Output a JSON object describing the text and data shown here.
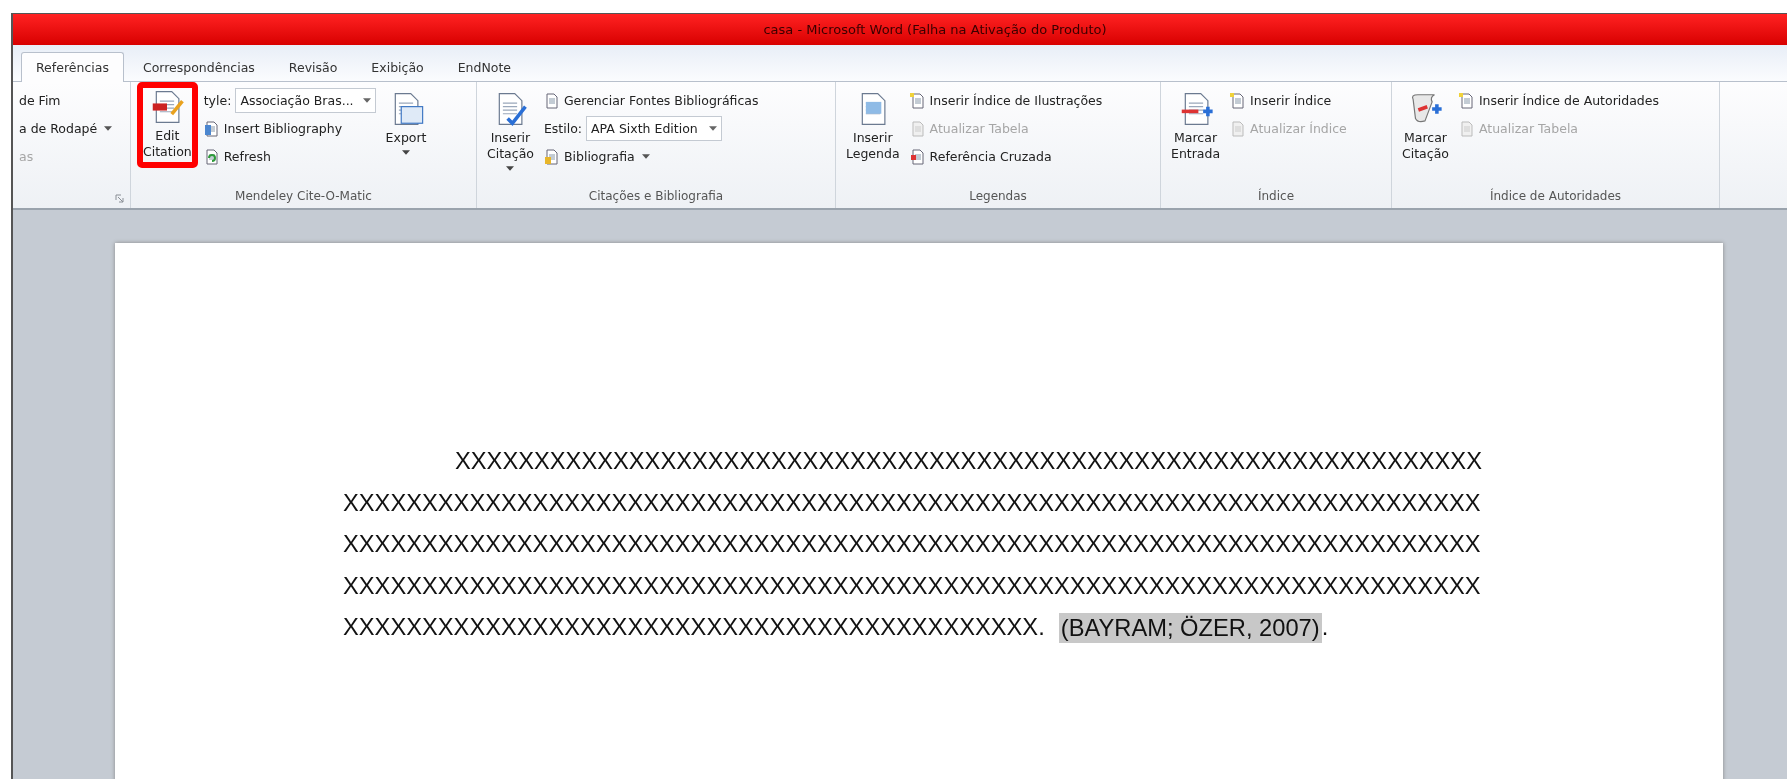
{
  "window": {
    "title": "casa - Microsoft Word (Falha na Ativação do Produto)"
  },
  "tabs": [
    {
      "label": "Referências",
      "selected": true
    },
    {
      "label": "Correspondências",
      "selected": false
    },
    {
      "label": "Revisão",
      "selected": false
    },
    {
      "label": "Exibição",
      "selected": false
    },
    {
      "label": "EndNote",
      "selected": false
    }
  ],
  "ribbon": {
    "groups": [
      {
        "launcher": true,
        "items": [
          {
            "kind": "column",
            "rows": [
              {
                "kind": "button",
                "label": "de Fim",
                "disabled": false
              },
              {
                "kind": "button",
                "label": "a de Rodapé",
                "caret": true,
                "disabled": false
              },
              {
                "kind": "button",
                "label": "as",
                "disabled": true
              }
            ]
          }
        ]
      },
      {
        "label": "Mendeley Cite-O-Matic",
        "items": [
          {
            "kind": "large",
            "label": "Edit Citation",
            "highlighted": true
          },
          {
            "kind": "column",
            "rows": [
              {
                "kind": "combo",
                "label": "tyle:",
                "value": "Associação Bras..."
              },
              {
                "kind": "button",
                "label": "Insert Bibliography",
                "disabled": false
              },
              {
                "kind": "button",
                "label": "Refresh",
                "disabled": false
              }
            ]
          },
          {
            "kind": "large",
            "label": "Export",
            "caret": true,
            "highlighted": false
          }
        ]
      },
      {
        "label": "Citações e Bibliografia",
        "items": [
          {
            "kind": "large",
            "label": "Inserir Citação",
            "caret": true,
            "highlighted": false
          },
          {
            "kind": "column",
            "rows": [
              {
                "kind": "button",
                "label": "Gerenciar Fontes Bibliográficas",
                "disabled": false
              },
              {
                "kind": "combo",
                "label": "Estilo:",
                "value": "APA Sixth Edition"
              },
              {
                "kind": "button",
                "label": "Bibliografia",
                "caret": true,
                "disabled": false
              }
            ]
          }
        ]
      },
      {
        "label": "Legendas",
        "items": [
          {
            "kind": "large",
            "label": "Inserir Legenda",
            "highlighted": false
          },
          {
            "kind": "column",
            "rows": [
              {
                "kind": "button",
                "label": "Inserir Índice de Ilustrações",
                "disabled": false
              },
              {
                "kind": "button",
                "label": "Atualizar Tabela",
                "disabled": true
              },
              {
                "kind": "button",
                "label": "Referência Cruzada",
                "disabled": false
              }
            ]
          }
        ]
      },
      {
        "label": "Índice",
        "items": [
          {
            "kind": "large",
            "label": "Marcar Entrada",
            "highlighted": false
          },
          {
            "kind": "column",
            "rows": [
              {
                "kind": "button",
                "label": "Inserir Índice",
                "disabled": false
              },
              {
                "kind": "button",
                "label": "Atualizar Índice",
                "disabled": true
              }
            ]
          }
        ]
      },
      {
        "label": "Índice de Autoridades",
        "items": [
          {
            "kind": "large",
            "label": "Marcar Citação",
            "highlighted": false
          },
          {
            "kind": "column",
            "rows": [
              {
                "kind": "button",
                "label": "Inserir Índice de Autoridades",
                "disabled": false
              },
              {
                "kind": "button",
                "label": "Atualizar Tabela",
                "disabled": true
              }
            ]
          }
        ]
      }
    ]
  },
  "document": {
    "first_line": "XXXXXXXXXXXXXXXXXXXXXXXXXXXXXXXXXXXXXXXXXXXXXXXXXXXXXXXXXXXXXXXXX",
    "lines": [
      "XXXXXXXXXXXXXXXXXXXXXXXXXXXXXXXXXXXXXXXXXXXXXXXXXXXXXXXXXXXXXXXXXXXXXXXX",
      "XXXXXXXXXXXXXXXXXXXXXXXXXXXXXXXXXXXXXXXXXXXXXXXXXXXXXXXXXXXXXXXXXXXXXXXX",
      "XXXXXXXXXXXXXXXXXXXXXXXXXXXXXXXXXXXXXXXXXXXXXXXXXXXXXXXXXXXXXXXXXXXXXXXX"
    ],
    "last_line": "XXXXXXXXXXXXXXXXXXXXXXXXXXXXXXXXXXXXXXXXXXXX.",
    "citation": "(BAYRAM; ÖZER, 2007)",
    "after_citation": "."
  }
}
